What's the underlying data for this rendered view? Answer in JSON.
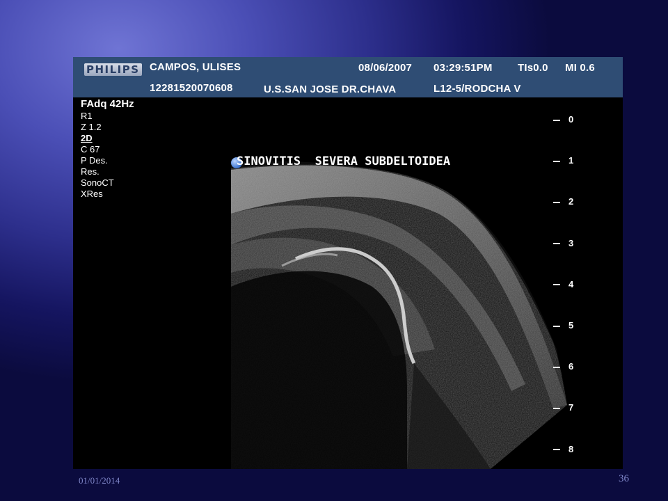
{
  "header": {
    "logo": "PHILIPS",
    "patient_name": "CAMPOS, ULISES",
    "date": "08/06/2007",
    "time": "03:29:51PM",
    "tis": "TIs0.0",
    "mi": "MI 0.6",
    "patient_id": "12281520070608",
    "institution": "U.S.SAN JOSE DR.CHAVA",
    "probe": "L12-5/RODCHA V"
  },
  "params": {
    "line1": "FAdq 42Hz",
    "line2": "R1",
    "line3": "Z 1.2",
    "line4": "2D",
    "line5": "C 67",
    "line6": "P Des.",
    "line7": "Res.",
    "line8": "SonoCT",
    "line9": "XRes"
  },
  "annotation": {
    "word1": "SINOVITIS",
    "word2": "SEVERA",
    "word3": "SUBDELTOIDEA"
  },
  "depth_scale": [
    "0",
    "1",
    "2",
    "3",
    "4",
    "5",
    "6",
    "7",
    "8"
  ],
  "footer": {
    "date": "01/01/2014",
    "slide_number": "36"
  }
}
